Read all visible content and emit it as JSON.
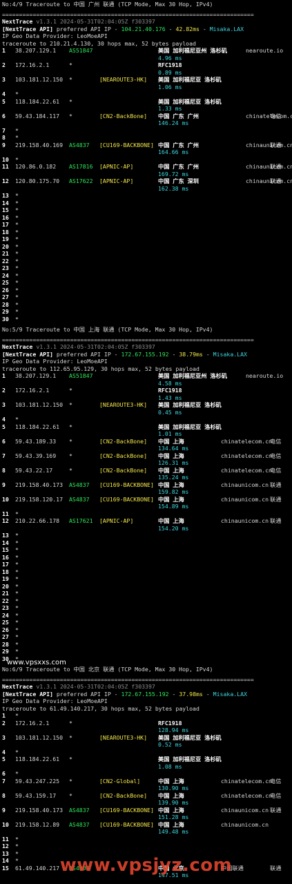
{
  "watermarks": [
    "www.vpsxxs.com",
    "www.vpsjyz.com"
  ],
  "sections": [
    {
      "title": "No:4/9 Traceroute to 中国 广州 联通 (TCP Mode, Max 30 Hop, IPv4)",
      "sep": "==========================================================================",
      "nt_label": "NextTrace",
      "nt_version": "v1.3.1 2024-05-31T02:04:05Z f303397",
      "api_prefix": "[NextTrace API]",
      "api_mid": " preferred API IP - ",
      "api_ip": "104.21.40.176",
      "api_dash": " - ",
      "api_ms": "42.82ms",
      "api_dash2": " - ",
      "api_node": "Misaka.LAX",
      "geo": "IP Geo Data Provider: LeoMoeAPI",
      "trace": "traceroute to 210.21.4.130, 30 hops max, 52 bytes payload",
      "hops": [
        {
          "n": "1",
          "ip": "38.207.129.1",
          "asn": "AS51847",
          "tag": "",
          "geo": "美国 加利福尼亚州 洛杉矶",
          "domain": "nearoute.io",
          "isp": "",
          "ms": "4.96 ms"
        },
        {
          "n": "2",
          "ip": "172.16.2.1",
          "asn": "*",
          "tag": "",
          "geo": "RFC1918",
          "domain": "",
          "isp": "",
          "ms": "0.89 ms"
        },
        {
          "n": "3",
          "ip": "103.181.12.150",
          "asn": "*",
          "tag": "[NEAROUTE3-HK]",
          "geo": "美国 加利福尼亚 洛杉矶",
          "domain": "",
          "isp": "",
          "ms": "1.06 ms"
        },
        {
          "n": "4",
          "ip": "*"
        },
        {
          "n": "5",
          "ip": "118.184.22.61",
          "asn": "*",
          "tag": "",
          "geo": "美国 加利福尼亚 洛杉矶",
          "domain": "",
          "isp": "",
          "ms": "1.33 ms"
        },
        {
          "n": "6",
          "ip": "59.43.184.117",
          "asn": "*",
          "tag": "[CN2-BackBone]",
          "geo": "中国 广东 广州",
          "domain": "chinatelecom.cn",
          "isp": "电信",
          "ms": "146.24 ms"
        },
        {
          "n": "7",
          "ip": "*"
        },
        {
          "n": "8",
          "ip": "*"
        },
        {
          "n": "9",
          "ip": "219.158.40.169",
          "asn": "AS4837",
          "tag": "[CU169-BACKBONE]",
          "geo": "中国 广东 广州",
          "domain": "chinaunicom.cn",
          "isp": "联通",
          "ms": "164.66 ms"
        },
        {
          "n": "10",
          "ip": "*"
        },
        {
          "n": "11",
          "ip": "120.86.0.182",
          "asn": "AS17816",
          "tag": "[APNIC-AP]",
          "geo": "中国 广东 广州",
          "domain": "chinaunicom.cn",
          "isp": "联通",
          "ms": "169.72 ms"
        },
        {
          "n": "12",
          "ip": "120.80.175.70",
          "asn": "AS17622",
          "tag": "[APNIC-AP]",
          "geo": "中国 广东 深圳",
          "domain": "chinaunicom.cn",
          "isp": "联通",
          "ms": "162.38 ms"
        },
        {
          "n": "13",
          "ip": "*"
        },
        {
          "n": "14",
          "ip": "*"
        },
        {
          "n": "15",
          "ip": "*"
        },
        {
          "n": "16",
          "ip": "*"
        },
        {
          "n": "17",
          "ip": "*"
        },
        {
          "n": "18",
          "ip": "*"
        },
        {
          "n": "19",
          "ip": "*"
        },
        {
          "n": "20",
          "ip": "*"
        },
        {
          "n": "21",
          "ip": "*"
        },
        {
          "n": "22",
          "ip": "*"
        },
        {
          "n": "23",
          "ip": "*"
        },
        {
          "n": "24",
          "ip": "*"
        },
        {
          "n": "25",
          "ip": "*"
        },
        {
          "n": "26",
          "ip": "*"
        },
        {
          "n": "27",
          "ip": "*"
        },
        {
          "n": "28",
          "ip": "*"
        },
        {
          "n": "29",
          "ip": "*"
        },
        {
          "n": "30",
          "ip": "*"
        }
      ]
    },
    {
      "title": "No:5/9 Traceroute to 中国 上海 联通 (TCP Mode, Max 30 Hop, IPv4)",
      "sep": "==========================================================================",
      "nt_label": "NextTrace",
      "nt_version": "v1.3.1 2024-05-31T02:04:05Z f303397",
      "api_prefix": "[NextTrace API]",
      "api_mid": " preferred API IP - ",
      "api_ip": "172.67.155.192",
      "api_dash": " - ",
      "api_ms": "38.79ms",
      "api_dash2": " - ",
      "api_node": "Misaka.LAX",
      "geo": "IP Geo Data Provider: LeoMoeAPI",
      "trace": "traceroute to 112.65.95.129, 30 hops max, 52 bytes payload",
      "hops": [
        {
          "n": "1",
          "ip": "38.207.129.1",
          "asn": "AS51847",
          "tag": "",
          "geo": "美国 加利福尼亚州 洛杉矶",
          "domain": "nearoute.io",
          "isp": "",
          "ms": "4.58 ms"
        },
        {
          "n": "2",
          "ip": "172.16.2.1",
          "asn": "*",
          "tag": "",
          "geo": "RFC1918",
          "domain": "",
          "isp": "",
          "ms": "1.43 ms"
        },
        {
          "n": "3",
          "ip": "103.181.12.150",
          "asn": "*",
          "tag": "[NEAROUTE3-HK]",
          "geo": "美国 加利福尼亚 洛杉矶",
          "domain": "",
          "isp": "",
          "ms": "0.45 ms"
        },
        {
          "n": "4",
          "ip": "*"
        },
        {
          "n": "5",
          "ip": "118.184.22.61",
          "asn": "*",
          "tag": "",
          "geo": "美国 加利福尼亚 洛杉矶",
          "domain": "",
          "isp": "",
          "ms": "1.01 ms"
        },
        {
          "n": "6",
          "ip": "59.43.189.33",
          "asn": "*",
          "tag": "[CN2-BackBone]",
          "geo": "中国 上海",
          "domain": "chinatelecom.cn",
          "isp": "电信",
          "ms": "134.64 ms"
        },
        {
          "n": "7",
          "ip": "59.43.39.169",
          "asn": "*",
          "tag": "[CN2-BackBone]",
          "geo": "中国 上海",
          "domain": "chinatelecom.cn",
          "isp": "电信",
          "ms": "126.31 ms"
        },
        {
          "n": "8",
          "ip": "59.43.22.17",
          "asn": "*",
          "tag": "[CN2-BackBone]",
          "geo": "中国 上海",
          "domain": "chinatelecom.cn",
          "isp": "电信",
          "ms": "135.24 ms"
        },
        {
          "n": "9",
          "ip": "219.158.40.173",
          "asn": "AS4837",
          "tag": "[CU169-BACKBONE]",
          "geo": "中国 上海",
          "domain": "chinaunicom.cn",
          "isp": "联通",
          "ms": "159.82 ms"
        },
        {
          "n": "10",
          "ip": "219.158.120.17",
          "asn": "AS4837",
          "tag": "[CU169-BACKBONE]",
          "geo": "中国 上海",
          "domain": "chinaunicom.cn",
          "isp": "联通",
          "ms": "154.89 ms"
        },
        {
          "n": "11",
          "ip": "*"
        },
        {
          "n": "12",
          "ip": "210.22.66.178",
          "asn": "AS17621",
          "tag": "[APNIC-AP]",
          "geo": "中国 上海",
          "domain": "chinaunicom.cn",
          "isp": "联通",
          "ms": "154.20 ms"
        },
        {
          "n": "13",
          "ip": "*"
        },
        {
          "n": "14",
          "ip": "*"
        },
        {
          "n": "15",
          "ip": "*"
        },
        {
          "n": "16",
          "ip": "*"
        },
        {
          "n": "17",
          "ip": "*"
        },
        {
          "n": "18",
          "ip": "*"
        },
        {
          "n": "19",
          "ip": "*"
        },
        {
          "n": "20",
          "ip": "*"
        },
        {
          "n": "21",
          "ip": "*"
        },
        {
          "n": "22",
          "ip": "*"
        },
        {
          "n": "23",
          "ip": "*"
        },
        {
          "n": "24",
          "ip": "*"
        },
        {
          "n": "25",
          "ip": "*"
        },
        {
          "n": "26",
          "ip": "*"
        },
        {
          "n": "27",
          "ip": "*"
        },
        {
          "n": "28",
          "ip": "*"
        },
        {
          "n": "29",
          "ip": "*"
        },
        {
          "n": "30",
          "ip": "*"
        }
      ]
    },
    {
      "title": "No:6/9 Traceroute to 中国 北京 联通 (TCP Mode, Max 30 Hop, IPv4)",
      "sep": "==========================================================================",
      "nt_label": "NextTrace",
      "nt_version": "v1.3.1 2024-05-31T02:04:05Z f303397",
      "api_prefix": "[NextTrace API]",
      "api_mid": " preferred API IP - ",
      "api_ip": "172.67.155.192",
      "api_dash": " - ",
      "api_ms": "37.98ms",
      "api_dash2": " - ",
      "api_node": "Misaka.LAX",
      "geo": "IP Geo Data Provider: LeoMoeAPI",
      "trace": "traceroute to 61.49.140.217, 30 hops max, 52 bytes payload",
      "hops": [
        {
          "n": "1",
          "ip": "*"
        },
        {
          "n": "2",
          "ip": "172.16.2.1",
          "asn": "*",
          "tag": "",
          "geo": "RFC1918",
          "domain": "",
          "isp": "",
          "ms": "128.94 ms"
        },
        {
          "n": "3",
          "ip": "103.181.12.150",
          "asn": "*",
          "tag": "[NEAROUTE3-HK]",
          "geo": "美国 加利福尼亚 洛杉矶",
          "domain": "",
          "isp": "",
          "ms": "0.52 ms"
        },
        {
          "n": "4",
          "ip": "*"
        },
        {
          "n": "5",
          "ip": "118.184.22.61",
          "asn": "*",
          "tag": "",
          "geo": "美国 加利福尼亚 洛杉矶",
          "domain": "",
          "isp": "",
          "ms": "1.08 ms"
        },
        {
          "n": "6",
          "ip": "*"
        },
        {
          "n": "7",
          "ip": "59.43.247.225",
          "asn": "*",
          "tag": "[CN2-Global]",
          "geo": "中国 上海",
          "domain": "chinatelecom.cn",
          "isp": "电信",
          "ms": "130.90 ms"
        },
        {
          "n": "8",
          "ip": "59.43.159.17",
          "asn": "*",
          "tag": "[CN2-BackBone]",
          "geo": "中国 上海",
          "domain": "chinatelecom.cn",
          "isp": "电信",
          "ms": "139.90 ms"
        },
        {
          "n": "9",
          "ip": "219.158.40.173",
          "asn": "AS4837",
          "tag": "[CU169-BACKBONE]",
          "geo": "中国 上海",
          "domain": "chinaunicom.cn",
          "isp": "联通",
          "ms": "151.28 ms"
        },
        {
          "n": "10",
          "ip": "219.158.12.89",
          "asn": "AS4837",
          "tag": "[CU169-BACKBONE]",
          "geo": "中国 上海",
          "domain": "chinaunicom.cn",
          "isp": "",
          "ms": "149.48 ms"
        },
        {
          "n": "11",
          "ip": "*"
        },
        {
          "n": "12",
          "ip": "*"
        },
        {
          "n": "13",
          "ip": "*"
        },
        {
          "n": "14",
          "ip": "*"
        },
        {
          "n": "15",
          "ip": "61.49.140.217",
          "asn": "AS4808",
          "tag": "",
          "geo": "中国 北京",
          "domain": "中国联通",
          "isp": "联通",
          "ms": "147.51 ms"
        }
      ]
    }
  ]
}
